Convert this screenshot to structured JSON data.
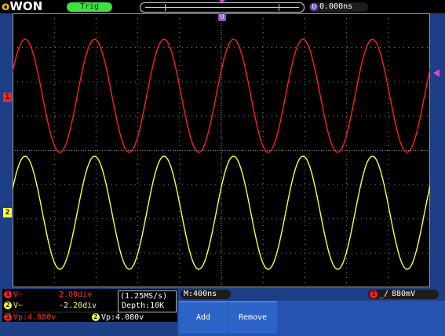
{
  "brand": {
    "logo_o": "o",
    "logo_rest": "WON"
  },
  "top": {
    "trig_status": "Trig",
    "time_offset_badge": "U",
    "time_offset": "0.000ns"
  },
  "screen": {
    "u_marker": "U",
    "ch1_marker": "1",
    "ch2_marker": "2"
  },
  "channels": {
    "ch1": {
      "badge": "1",
      "coupling": "V~",
      "scale": "2.00div"
    },
    "ch2": {
      "badge": "2",
      "coupling": "V~",
      "scale": "-2.20div"
    }
  },
  "measurements": {
    "vp1_badge": "1",
    "vp1": "Vp:4.080v",
    "vp2_badge": "2",
    "vp2": "Vp:4.080v"
  },
  "acquisition": {
    "rate": "(1.25MS/s)",
    "depth": "Depth:10K"
  },
  "timebase": "M:400ns",
  "trigger": {
    "badge": "1",
    "edge": "_/",
    "level": "880mV"
  },
  "menu": {
    "add_label": "Add",
    "remove_label": "Remove"
  },
  "colors": {
    "ch1": "#ff2020",
    "ch2": "#ffff30",
    "menu": "#2c64c8",
    "trig": "#3fe03f"
  }
}
